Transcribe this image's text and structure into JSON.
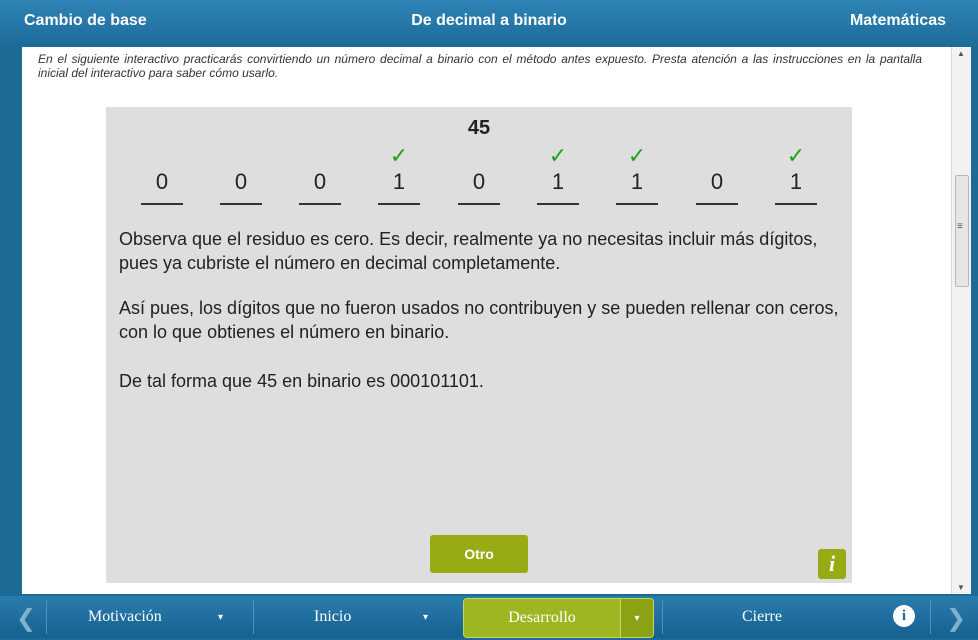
{
  "header": {
    "left": "Cambio de base",
    "center": "De decimal a binario",
    "right": "Matemáticas"
  },
  "intro": "En el siguiente interactivo practicarás convirtiendo un número decimal a binario con el método antes expuesto. Presta atención a las instrucciones en la pantalla inicial del interactivo para saber cómo usarlo.",
  "panel": {
    "number": "45",
    "digits": [
      {
        "value": "0",
        "check": ""
      },
      {
        "value": "0",
        "check": ""
      },
      {
        "value": "0",
        "check": ""
      },
      {
        "value": "1",
        "check": "✓"
      },
      {
        "value": "0",
        "check": ""
      },
      {
        "value": "1",
        "check": "✓"
      },
      {
        "value": "1",
        "check": "✓"
      },
      {
        "value": "0",
        "check": ""
      },
      {
        "value": "1",
        "check": "✓"
      }
    ],
    "paragraph1": "Observa que el residuo es cero. Es decir, realmente ya no necesitas incluir más dígitos, pues ya cubriste el número en decimal completamente.",
    "paragraph2": "Así pues, los dígitos que no fueron usados no contribuyen y se pueden rellenar con ceros, con lo que obtienes el número en binario.",
    "paragraph3": "De tal forma que 45 en binario es 000101101.",
    "otro_label": "Otro",
    "info_label": "i"
  },
  "scrollbar": {
    "up": "▲",
    "down": "▼",
    "grip": "≡"
  },
  "nav": {
    "prev": "❮",
    "next": "❯",
    "items": [
      {
        "label": "Motivación",
        "caret": "▾"
      },
      {
        "label": "Inicio",
        "caret": "▾"
      },
      {
        "label": "Desarrollo",
        "caret": "▾"
      },
      {
        "label": "Cierre"
      }
    ],
    "info": "i"
  },
  "colors": {
    "header": "#2e84b5",
    "accent_green": "#98ab14",
    "check_green": "#1ca61c",
    "panel": "#dedede"
  }
}
